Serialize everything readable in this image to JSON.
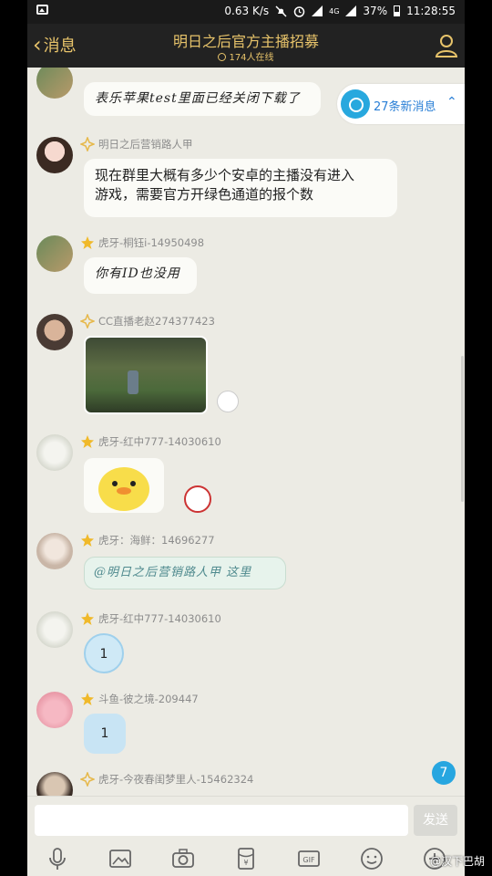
{
  "status_bar": {
    "speed": "0.63 K/s",
    "net": "4G",
    "battery": "37%",
    "time": "11:28:55"
  },
  "header": {
    "back_label": "消息",
    "title": "明日之后官方主播招募",
    "online": "174人在线"
  },
  "new_messages": {
    "label": "27条新消息"
  },
  "messages": [
    {
      "sender": "",
      "text": "表乐苹果test里面已经关闭下载了"
    },
    {
      "sender": "明日之后营销路人甲",
      "text_line1": "现在群里大概有多少个安卓的主播没有进入",
      "text_line2": "游戏，需要官方开绿色通道的报个数"
    },
    {
      "sender": "虎牙-桐钰i-14950498",
      "text": "你有ID也没用"
    },
    {
      "sender": "CC直播老赵274377423",
      "text": ""
    },
    {
      "sender": "虎牙-红中777-14030610",
      "text": ""
    },
    {
      "sender": "虎牙：海鲜：14696277",
      "text": "@明日之后营销路人甲 这里"
    },
    {
      "sender": "虎牙-红中777-14030610",
      "text": "1"
    },
    {
      "sender": "斗鱼-彼之境-209447",
      "text": "1"
    },
    {
      "sender": "虎牙-今夜春闺梦里人-15462324",
      "text": ""
    }
  ],
  "unread_count": "7",
  "composer": {
    "placeholder": "",
    "send_label": "发送"
  },
  "toolbar_icons": [
    "mic-icon",
    "image-icon",
    "camera-icon",
    "redpacket-icon",
    "gif-icon",
    "emoji-icon",
    "plus-icon"
  ],
  "watermark": "@汉下巴胡",
  "colors": {
    "header_bg": "#222222",
    "gold": "#e7c36a",
    "chat_bg": "#ecebe4",
    "accent_blue": "#27a6e0"
  }
}
